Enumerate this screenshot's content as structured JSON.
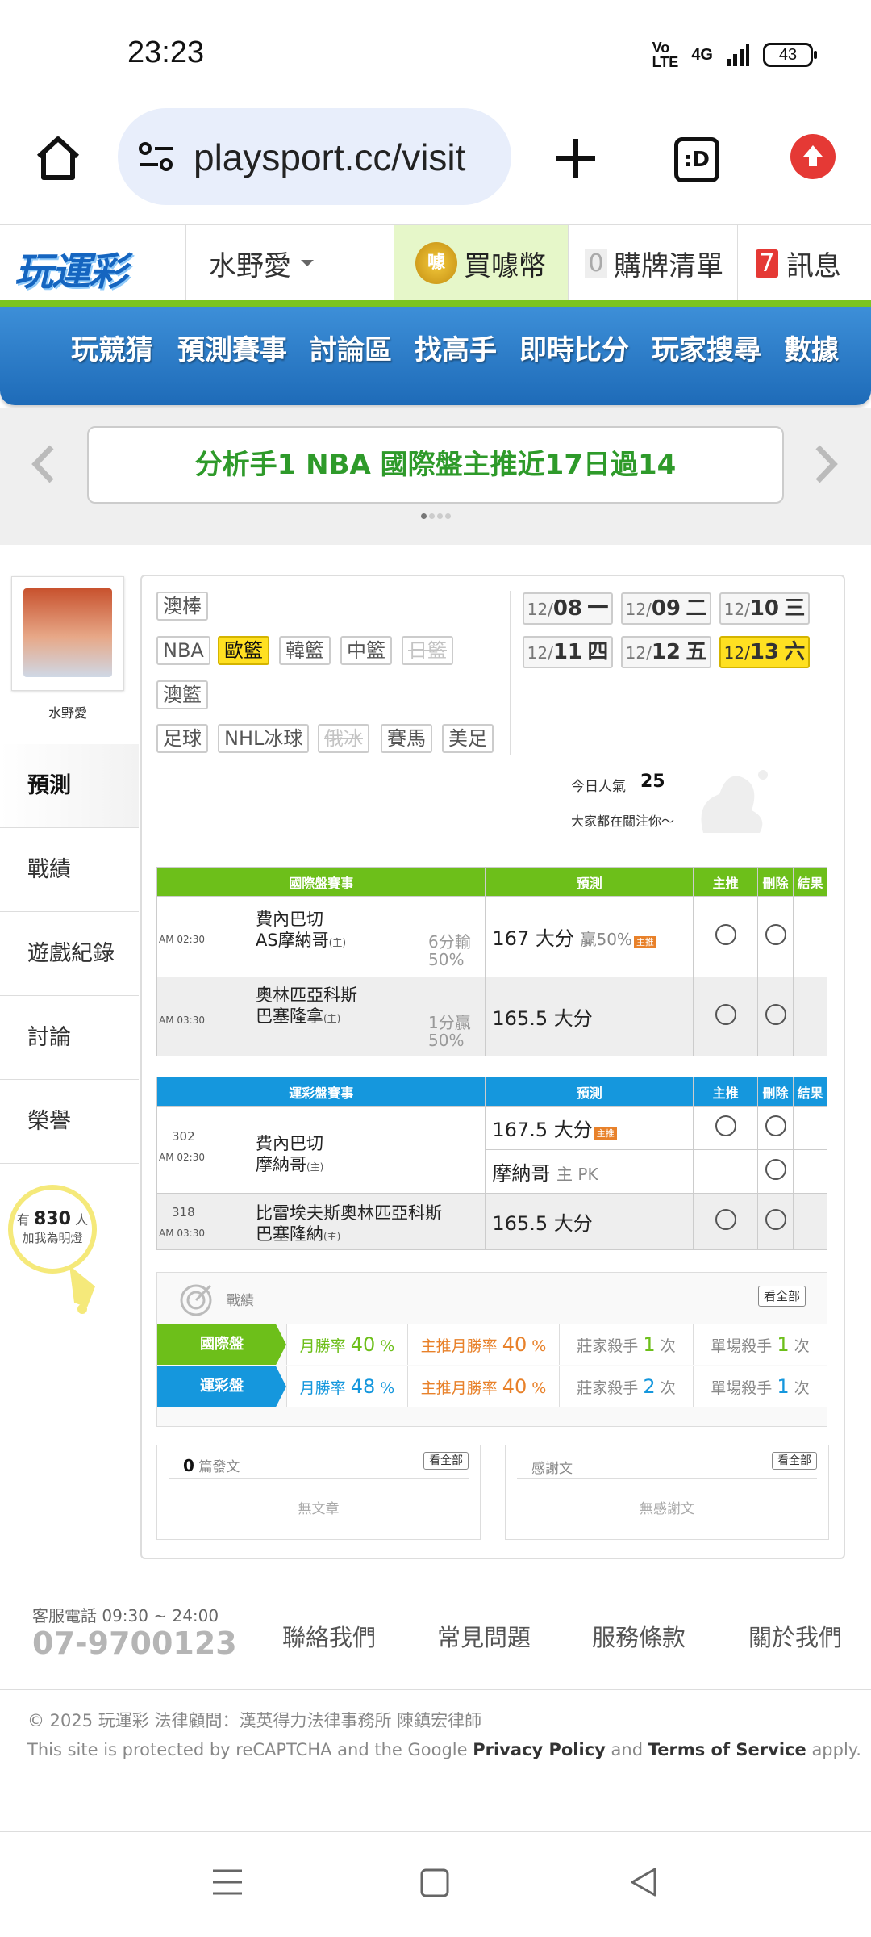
{
  "status_bar": {
    "time": "23:23",
    "network": "4G",
    "volte": "Vo LTE",
    "battery": "43"
  },
  "browser": {
    "url": "playsport.cc/visit",
    "tab_label": ":D"
  },
  "site_header": {
    "logo": "玩運彩",
    "user": "水野愛",
    "coins": "買噱幣",
    "coin_icon": "噱",
    "cart_count": "0",
    "cart": "購牌清單",
    "msg_count": "7",
    "messages": "訊息"
  },
  "nav": [
    "玩競猜",
    "預測賽事",
    "討論區",
    "找高手",
    "即時比分",
    "玩家搜尋",
    "數據"
  ],
  "banner": {
    "text": "分析手1 NBA 國際盤主推近17日過14"
  },
  "profile": {
    "name": "水野愛"
  },
  "sidebar": {
    "items": [
      "預測",
      "戰績",
      "遊戲紀錄",
      "討論",
      "榮譽"
    ]
  },
  "fans": {
    "prefix": "有",
    "count": "830",
    "suffix": "人",
    "line2": "加我為明燈"
  },
  "sports": {
    "row1": [
      "澳棒"
    ],
    "row2": [
      "NBA",
      "歐籃",
      "韓籃",
      "中籃",
      "日籃"
    ],
    "row3": [
      "澳籃"
    ],
    "row4": [
      "足球",
      "NHL冰球",
      "俄冰",
      "賽馬",
      "美足"
    ]
  },
  "dates": [
    {
      "m": "12/",
      "d": "08",
      "w": "一"
    },
    {
      "m": "12/",
      "d": "09",
      "w": "二"
    },
    {
      "m": "12/",
      "d": "10",
      "w": "三"
    },
    {
      "m": "12/",
      "d": "11",
      "w": "四"
    },
    {
      "m": "12/",
      "d": "12",
      "w": "五"
    },
    {
      "m": "12/",
      "d": "13",
      "w": "六"
    }
  ],
  "popularity": {
    "label": "今日人氣",
    "value": "25",
    "note": "大家都在關注你～"
  },
  "intl_table": {
    "headers": [
      "國際盤賽事",
      "預測",
      "主推",
      "刪除",
      "結果"
    ],
    "rows": [
      {
        "time": "AM 02:30",
        "team1": "費內巴切",
        "team2": "AS摩納哥",
        "home": "(主)",
        "line1": "6分輸",
        "line2": "50%",
        "pick": "167 大分",
        "extra": "贏50%",
        "badge": "主推"
      },
      {
        "time": "AM 03:30",
        "team1": "奧林匹亞科斯",
        "team2": "巴塞隆拿",
        "home": "(主)",
        "line1": "1分贏",
        "line2": "50%",
        "pick": "165.5 大分"
      }
    ]
  },
  "lottery_table": {
    "headers": [
      "運彩盤賽事",
      "預測",
      "主推",
      "刪除",
      "結果"
    ],
    "rows": [
      {
        "num": "302",
        "time": "AM 02:30",
        "team1": "費內巴切",
        "team2": "摩納哥",
        "home": "(主)",
        "pick1": "167.5 大分",
        "badge": "主推",
        "pick2": "摩納哥",
        "pick2_extra": "主 PK"
      },
      {
        "num": "318",
        "time": "AM 03:30",
        "team1": "比雷埃夫斯奧林匹亞科斯",
        "team2": "巴塞隆納",
        "home": "(主)",
        "pick1": "165.5 大分"
      }
    ]
  },
  "records": {
    "title": "戰績",
    "view_all": "看全部",
    "rows": [
      {
        "label": "國際盤",
        "c1": "月勝率",
        "v1": "40",
        "u1": "%",
        "c2": "主推月勝率",
        "v2": "40",
        "u2": "%",
        "c3": "莊家殺手",
        "v3": "1",
        "u3": "次",
        "c4": "單場殺手",
        "v4": "1",
        "u4": "次"
      },
      {
        "label": "運彩盤",
        "c1": "月勝率",
        "v1": "48",
        "u1": "%",
        "c2": "主推月勝率",
        "v2": "40",
        "u2": "%",
        "c3": "莊家殺手",
        "v3": "2",
        "u3": "次",
        "c4": "單場殺手",
        "v4": "1",
        "u4": "次"
      }
    ]
  },
  "posts": {
    "count": "0",
    "label": "篇發文",
    "view_all": "看全部",
    "empty": "無文章"
  },
  "thanks": {
    "label": "感謝文",
    "view_all": "看全部",
    "empty": "無感謝文"
  },
  "footer": {
    "hours": "客服電話 09:30 ~ 24:00",
    "phone": "07-9700123",
    "links": [
      "聯絡我們",
      "常見問題",
      "服務條款",
      "關於我們"
    ],
    "copyright": "© 2025 玩運彩 法律顧問：漢英得力法律事務所 陳鎮宏律師",
    "recaptcha_pre": "This site is protected by reCAPTCHA and the Google",
    "privacy": "Privacy Policy",
    "and": "and",
    "terms": "Terms of Service",
    "apply": "apply."
  },
  "colors": {
    "green": "#6dbf1a",
    "blue": "#1597dd",
    "yellow": "#ffe021",
    "orange": "#e8812a",
    "nav_blue": "#2a7cc9"
  }
}
